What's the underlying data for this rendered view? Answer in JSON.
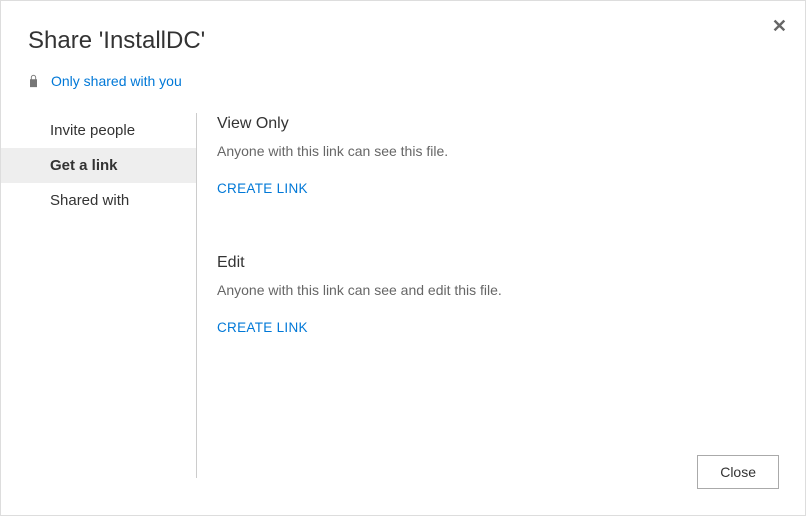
{
  "dialog": {
    "title": "Share 'InstallDC'",
    "close_button_label": "Close"
  },
  "status": {
    "icon": "lock-icon",
    "text": "Only shared with you"
  },
  "tabs": [
    {
      "label": "Invite people",
      "active": false
    },
    {
      "label": "Get a link",
      "active": true
    },
    {
      "label": "Shared with",
      "active": false
    }
  ],
  "sections": {
    "view": {
      "title": "View Only",
      "description": "Anyone with this link can see this file.",
      "action_label": "CREATE LINK"
    },
    "edit": {
      "title": "Edit",
      "description": "Anyone with this link can see and edit this file.",
      "action_label": "CREATE LINK"
    }
  }
}
